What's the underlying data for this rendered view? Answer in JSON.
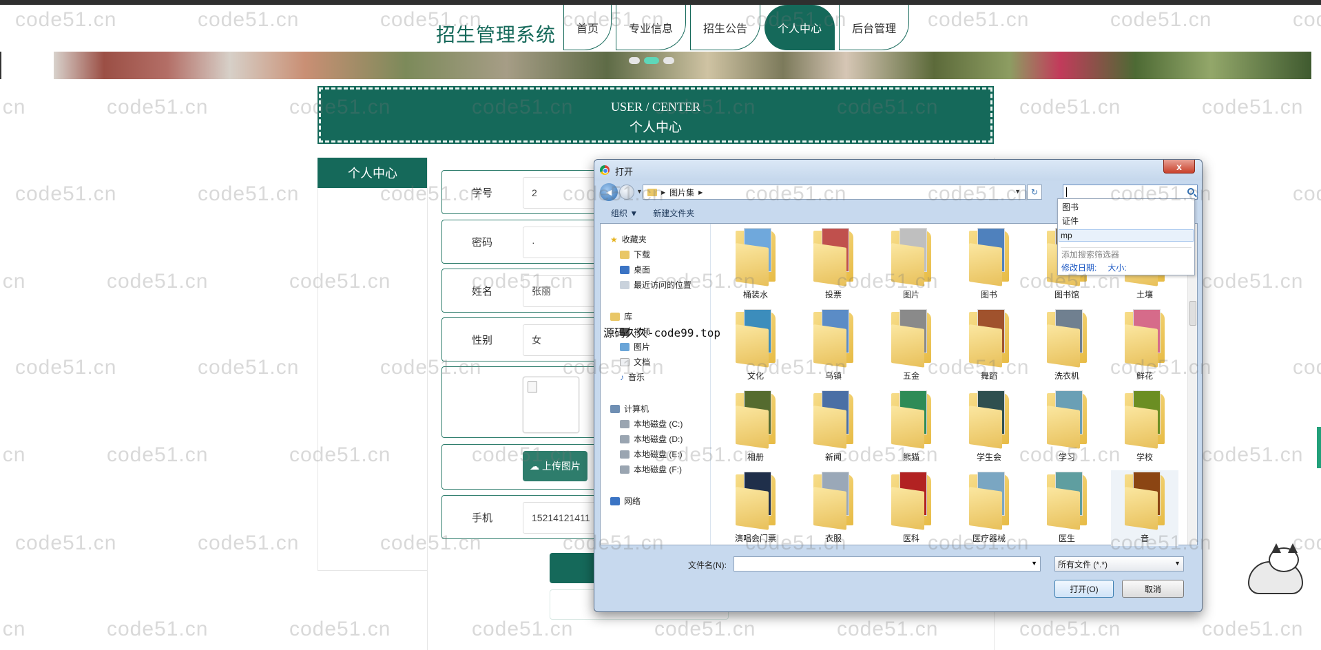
{
  "site": {
    "title": "招生管理系统",
    "nav": [
      {
        "label": "首页",
        "active": false
      },
      {
        "label": "专业信息",
        "active": false
      },
      {
        "label": "招生公告",
        "active": false
      },
      {
        "label": "个人中心",
        "active": true
      },
      {
        "label": "后台管理",
        "active": false
      }
    ],
    "accent_color": "#15695a"
  },
  "center_banner": {
    "en": "USER / CENTER",
    "cn": "个人中心"
  },
  "sidebar": {
    "title": "个人中心"
  },
  "form": {
    "fields": [
      {
        "label": "学号",
        "value": "2"
      },
      {
        "label": "密码",
        "value": "·"
      },
      {
        "label": "姓名",
        "value": "张丽"
      },
      {
        "label": "性别",
        "value": "女"
      },
      {
        "label": "手机",
        "value": "15214121411"
      }
    ],
    "upload_label": "上传图片"
  },
  "watermark": "code51.cn",
  "overlay_text": "源码久久-code99.top",
  "dialog": {
    "title": "打开",
    "close_label": "x",
    "path": [
      "图片集"
    ],
    "toolbar": {
      "organize": "组织 ▼",
      "new_folder": "新建文件夹"
    },
    "nav_pane": [
      {
        "label": "收藏夹",
        "icon": "star-icon"
      },
      {
        "label": "下载",
        "icon": "download-folder-icon"
      },
      {
        "label": "桌面",
        "icon": "desktop-icon"
      },
      {
        "label": "最近访问的位置",
        "icon": "recent-places-icon"
      },
      {
        "label": "库",
        "icon": "library-icon"
      },
      {
        "label": "视频",
        "icon": "video-icon"
      },
      {
        "label": "图片",
        "icon": "pictures-icon"
      },
      {
        "label": "文档",
        "icon": "documents-icon"
      },
      {
        "label": "音乐",
        "icon": "music-icon"
      },
      {
        "label": "计算机",
        "icon": "computer-icon"
      },
      {
        "label": "本地磁盘 (C:)",
        "icon": "drive-icon"
      },
      {
        "label": "本地磁盘 (D:)",
        "icon": "drive-icon"
      },
      {
        "label": "本地磁盘 (E:)",
        "icon": "drive-icon"
      },
      {
        "label": "本地磁盘 (F:)",
        "icon": "drive-icon"
      },
      {
        "label": "网络",
        "icon": "network-icon"
      }
    ],
    "folders": [
      "桶装水",
      "投票",
      "图片",
      "图书",
      "图书馆",
      "土壤",
      "文化",
      "乌镇",
      "五金",
      "舞蹈",
      "洗衣机",
      "鲜花",
      "相册",
      "新闻",
      "熊猫",
      "学生会",
      "学习",
      "学校",
      "演唱会门票",
      "衣服",
      "医科",
      "医疗器械",
      "医生",
      "音"
    ],
    "search_suggestions": [
      "图书",
      "证件",
      "mp"
    ],
    "add_filter": "添加搜索筛选器",
    "filter_links": [
      "修改日期:",
      "大小:"
    ],
    "filename_label": "文件名(N):",
    "filename_value": "",
    "filetype": "所有文件 (*.*)",
    "open_label": "打开(O)",
    "cancel_label": "取消"
  }
}
